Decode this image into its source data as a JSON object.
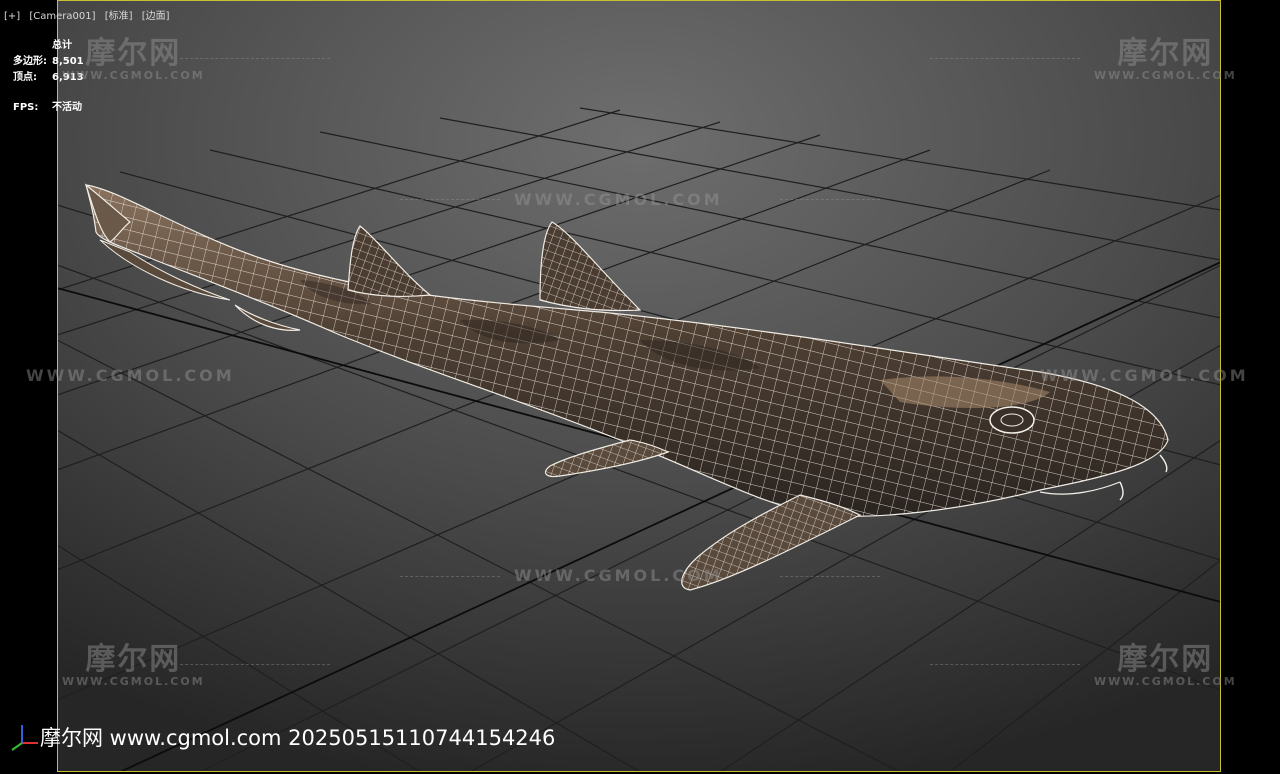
{
  "viewport": {
    "menu": [
      "[+]",
      "[Camera001]",
      "[标准]",
      "[边面]"
    ],
    "stats": {
      "total_label": "总计",
      "polygons_label": "多边形:",
      "polygons_value": "8,501",
      "vertices_label": "顶点:",
      "vertices_value": "6,913",
      "fps_label": "FPS:",
      "fps_value": "不活动"
    }
  },
  "watermarks": {
    "logo_text": "摩尔网",
    "logo_sub": "WWW.CGMOL.COM",
    "center_text": "WWW.CGMOL.COM"
  },
  "footer": {
    "text": "摩尔网 www.cgmol.com 20250515110744154246"
  },
  "colors": {
    "frame_border": "#c8c030",
    "grid": "#1a1a1a",
    "wire": "#f0ece4",
    "shark_body": "#5a4a3c"
  }
}
